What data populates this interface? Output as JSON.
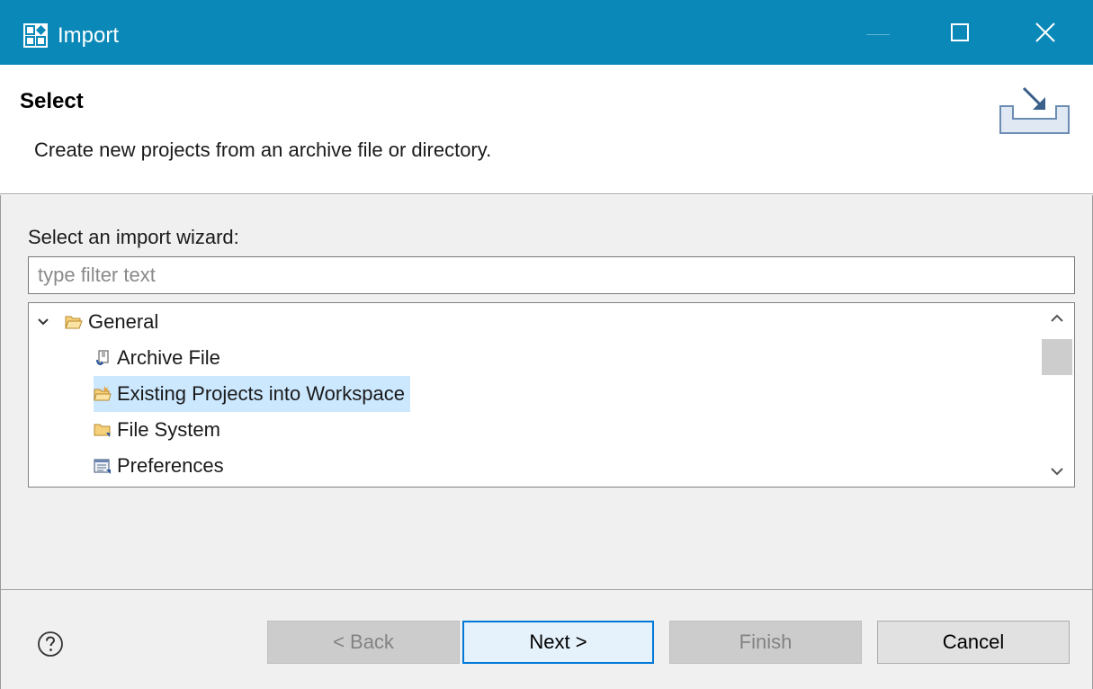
{
  "window": {
    "title": "Import",
    "icon": "import-wizard-app-icon",
    "controls": [
      "minimize-icon",
      "maximize-icon",
      "close-icon"
    ]
  },
  "banner": {
    "title": "Select",
    "description": "Create new projects from an archive file or directory.",
    "icon": "import-banner-icon"
  },
  "wizard": {
    "label": "Select an import wizard:",
    "filter_placeholder": "type filter text",
    "filter_value": ""
  },
  "tree": {
    "items": [
      {
        "label": "General",
        "icon": "folder-open-icon",
        "expanded": true,
        "level": 0
      },
      {
        "label": "Archive File",
        "icon": "archive-file-icon",
        "level": 1
      },
      {
        "label": "Existing Projects into Workspace",
        "icon": "existing-projects-icon",
        "level": 1,
        "selected": true
      },
      {
        "label": "File System",
        "icon": "file-system-folder-icon",
        "level": 1
      },
      {
        "label": "Preferences",
        "icon": "preferences-icon",
        "level": 1
      }
    ]
  },
  "buttons": {
    "back": "< Back",
    "next": "Next >",
    "finish": "Finish",
    "cancel": "Cancel"
  },
  "colors": {
    "titlebar": "#0a89b9",
    "selection": "#cce8ff",
    "default_button_border": "#0078d7"
  }
}
